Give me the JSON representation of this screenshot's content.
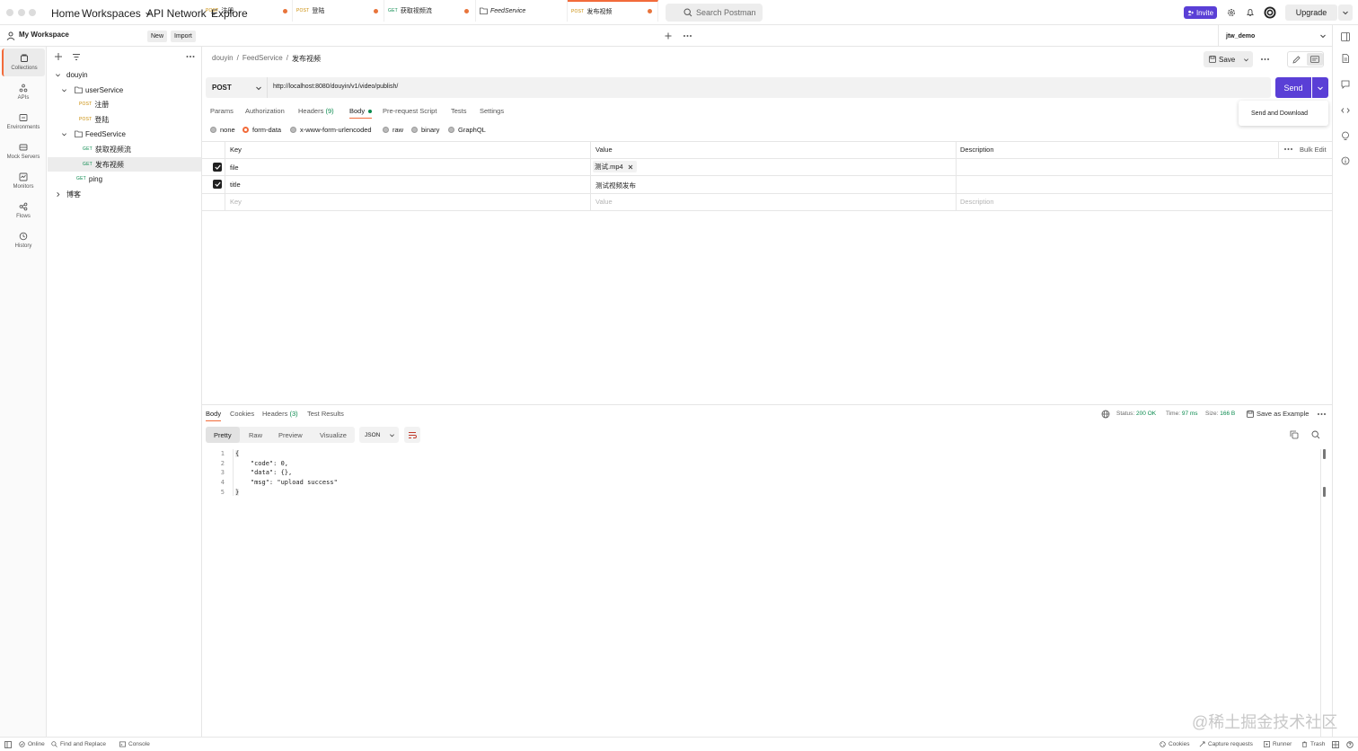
{
  "topbar": {
    "nav": [
      "Home",
      "Workspaces",
      "API Network",
      "Explore"
    ],
    "search_placeholder": "Search Postman",
    "invite_label": "Invite",
    "upgrade_label": "Upgrade"
  },
  "rail": [
    {
      "label": "Collections",
      "icon": "collections-icon"
    },
    {
      "label": "APIs",
      "icon": "apis-icon"
    },
    {
      "label": "Environments",
      "icon": "environments-icon"
    },
    {
      "label": "Mock Servers",
      "icon": "mock-servers-icon"
    },
    {
      "label": "Monitors",
      "icon": "monitors-icon"
    },
    {
      "label": "Flows",
      "icon": "flows-icon"
    },
    {
      "label": "History",
      "icon": "history-icon"
    }
  ],
  "workspace": {
    "title": "My Workspace",
    "new_label": "New",
    "import_label": "Import"
  },
  "tree": [
    {
      "label": "douyin",
      "method": "",
      "kind": "collection"
    },
    {
      "label": "userService",
      "method": "",
      "kind": "folder"
    },
    {
      "label": "注册",
      "method": "POST",
      "kind": "request"
    },
    {
      "label": "登陆",
      "method": "POST",
      "kind": "request"
    },
    {
      "label": "FeedService",
      "method": "",
      "kind": "folder"
    },
    {
      "label": "获取视频流",
      "method": "GET",
      "kind": "request"
    },
    {
      "label": "发布视频",
      "method": "GET",
      "kind": "request"
    },
    {
      "label": "ping",
      "method": "GET",
      "kind": "request"
    },
    {
      "label": "博客",
      "method": "",
      "kind": "collection"
    }
  ],
  "tabs": [
    {
      "method": "POST",
      "label": "注册"
    },
    {
      "method": "POST",
      "label": "登陆"
    },
    {
      "method": "GET",
      "label": "获取视频流"
    },
    {
      "method": "",
      "label": "FeedService"
    },
    {
      "method": "POST",
      "label": "发布视频"
    }
  ],
  "environment": "jtw_demo",
  "breadcrumb": [
    "douyin",
    "/",
    "FeedService",
    "/",
    "发布视频"
  ],
  "save_label": "Save",
  "request": {
    "method": "POST",
    "url": "http://localhost:8080/douyin/v1/video/publish/",
    "send_label": "Send",
    "send_menu_item": "Send and Download"
  },
  "request_tabs": [
    "Params",
    "Authorization",
    "Headers",
    "(9)",
    "Body",
    "Pre-request Script",
    "Tests",
    "Settings"
  ],
  "body_modes": [
    "none",
    "form-data",
    "x-www-form-urlencoded",
    "raw",
    "binary",
    "GraphQL"
  ],
  "table": {
    "headers": [
      "Key",
      "Value",
      "Description"
    ],
    "bulk_edit": "Bulk Edit",
    "rows": [
      {
        "key": "file",
        "value": "测试.mp4"
      },
      {
        "key": "title",
        "value": "测试视频发布"
      }
    ],
    "placeholder": {
      "key": "Key",
      "value": "Value",
      "description": "Description"
    }
  },
  "response": {
    "tabs": [
      "Body",
      "Cookies",
      "Headers",
      "(3)",
      "Test Results"
    ],
    "status_label": "Status:",
    "status_value": "200 OK",
    "time_label": "Time:",
    "time_value": "97 ms",
    "size_label": "Size:",
    "size_value": "166 B",
    "save_example": "Save as Example",
    "formats": [
      "Pretty",
      "Raw",
      "Preview",
      "Visualize"
    ],
    "lang": "JSON",
    "lines": [
      "1",
      "2",
      "3",
      "4",
      "5"
    ],
    "code": [
      "{",
      "    \"code\": 0,",
      "    \"data\": {},",
      "    \"msg\": \"upload success\"",
      "}"
    ]
  },
  "statusbar": {
    "online": "Online",
    "find_replace": "Find and Replace",
    "console": "Console",
    "cookies": "Cookies",
    "capture": "Capture requests",
    "runner": "Runner",
    "trash": "Trash"
  },
  "watermark": "@稀土掘金技术社区",
  "colors": {
    "accent": "#f26b3a",
    "primary": "#5a3fd6",
    "get": "#0a8a4e",
    "post": "#c98a00"
  }
}
